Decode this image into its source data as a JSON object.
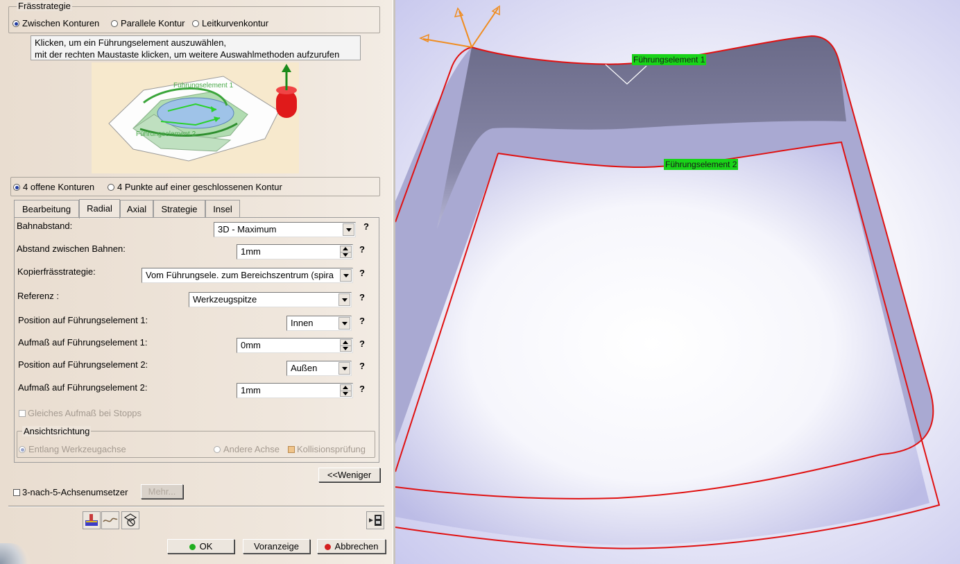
{
  "strategy": {
    "legend": "Frässtrategie",
    "options": [
      "Zwischen Konturen",
      "Parallele Kontur",
      "Leitkurvenkontur"
    ],
    "selected_index": 0
  },
  "tooltip": {
    "line1": "Klicken, um ein Führungselement auszuwählen,",
    "line2": "mit der rechten Maustaste klicken, um weitere Auswahlmethoden aufzurufen"
  },
  "illustration": {
    "label1": "Führungselement 1",
    "label2": "Führungselement 2"
  },
  "contour_options": [
    "4 offene Konturen",
    "4 Punkte auf einer geschlossenen Kontur"
  ],
  "contour_selected_index": 0,
  "tabs": [
    {
      "label": "Bearbeitung",
      "active": false
    },
    {
      "label": "Radial",
      "active": true
    },
    {
      "label": "Axial",
      "active": false
    },
    {
      "label": "Strategie",
      "active": false
    },
    {
      "label": "Insel",
      "active": false
    }
  ],
  "params": {
    "bahnabstand": {
      "label": "Bahnabstand:",
      "value": "3D - Maximum"
    },
    "abstand": {
      "label": "Abstand zwischen Bahnen:",
      "value": "1mm"
    },
    "kopier": {
      "label": "Kopierfrässtrategie:",
      "value": "Vom Führungsele. zum Bereichszentrum (spira"
    },
    "referenz": {
      "label": "Referenz :",
      "value": "Werkzeugspitze"
    },
    "pos1": {
      "label": "Position auf Führungselement 1:",
      "value": "Innen"
    },
    "aufmass1": {
      "label": "Aufmaß auf Führungselement 1:",
      "value": "0mm"
    },
    "pos2": {
      "label": "Position auf Führungselement 2:",
      "value": "Außen"
    },
    "aufmass2": {
      "label": "Aufmaß auf Führungselement 2:",
      "value": "1mm"
    }
  },
  "help_glyph": "?",
  "gleiches": "Gleiches Aufmaß bei Stopps",
  "ansicht": {
    "legend": "Ansichtsrichtung",
    "option1": "Entlang Werkzeugachse",
    "option2": "Andere Achse",
    "kollision": "Kollisionsprüfung"
  },
  "weniger_label": "<<Weniger",
  "converter": {
    "label": "3-nach-5-Achsenumsetzer",
    "mehr": "Mehr..."
  },
  "buttons": {
    "ok": "OK",
    "preview": "Voranzeige",
    "cancel": "Abbrechen"
  },
  "viewport": {
    "label1": "Führungselement 1",
    "label2": "Führungselement 2"
  },
  "colors": {
    "curve": "#e01010",
    "label_bg": "#19d419",
    "axis": "#f08c1e"
  }
}
